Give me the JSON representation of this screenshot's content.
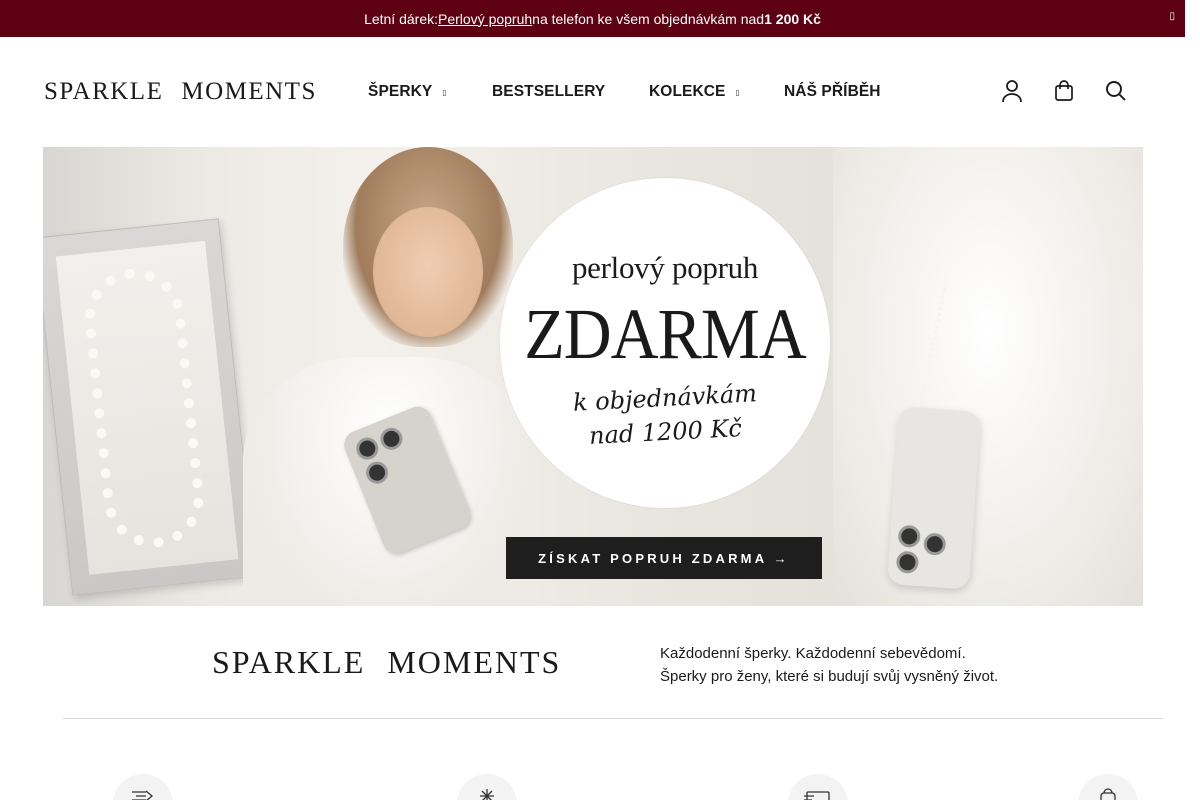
{
  "announcement": {
    "prefix": "Letní dárek: ",
    "link": "Perlový popruh ",
    "middle": "na telefon ke všem objednávkám nad ",
    "amount": "1 200 Kč",
    "close_icon": "close-icon"
  },
  "header": {
    "logo_word1": "SPARKLE",
    "logo_word2": "MOMENTS",
    "nav": [
      {
        "label": "ŠPERKY",
        "has_dropdown": true
      },
      {
        "label": "BESTSELLERY",
        "has_dropdown": false
      },
      {
        "label": "KOLEKCE",
        "has_dropdown": true
      },
      {
        "label": "NÁŠ PŘÍBĚH",
        "has_dropdown": false
      }
    ],
    "icons": [
      "account-icon",
      "cart-icon",
      "search-icon"
    ]
  },
  "hero": {
    "line1": "perlový popruh",
    "line2": "ZDARMA",
    "line3": "k objednávkám",
    "line4": "nad 1200 Kč",
    "cta": "ZÍSKAT POPRUH ZDARMA →"
  },
  "brand": {
    "word1": "SPARKLE",
    "word2": "MOMENTS",
    "tagline1": "Každodenní šperky. Každodenní sebevědomí.",
    "tagline2": "Šperky pro ženy, které si budují svůj vysněný život."
  },
  "benefits": [
    "shipping-icon",
    "sparkle-icon",
    "payment-icon",
    "gift-bag-icon"
  ],
  "colors": {
    "topbar": "#5c0012",
    "cta": "#1e1e1e",
    "text": "#1a1a1a"
  }
}
